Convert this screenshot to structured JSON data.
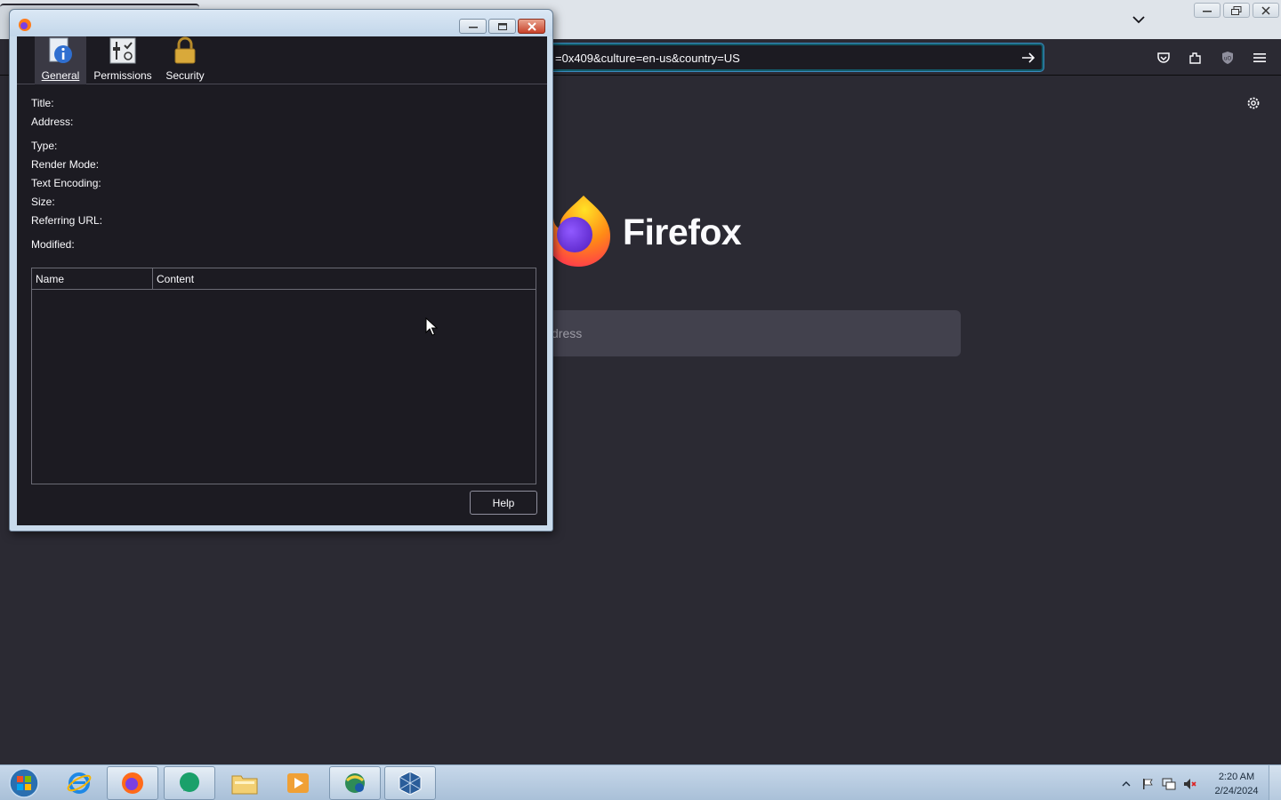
{
  "browser": {
    "url_text": "=0x409&culture=en-us&country=US",
    "brand": "Firefox",
    "search_placeholder": "dress"
  },
  "dialog": {
    "tabs": [
      {
        "label": "General",
        "icon": "info-icon"
      },
      {
        "label": "Permissions",
        "icon": "permissions-icon"
      },
      {
        "label": "Security",
        "icon": "lock-icon"
      }
    ],
    "fields": {
      "title": "Title:",
      "address": "Address:",
      "type": "Type:",
      "render_mode": "Render Mode:",
      "text_encoding": "Text Encoding:",
      "size": "Size:",
      "referring_url": "Referring URL:",
      "modified": "Modified:"
    },
    "table": {
      "columns": [
        "Name",
        "Content"
      ]
    },
    "help_label": "Help"
  },
  "taskbar": {
    "clock_time": "2:20 AM",
    "clock_date": "2/24/2024",
    "apps": [
      "internet-explorer",
      "firefox",
      "app-green",
      "file-explorer",
      "media-player",
      "network-app",
      "virtualbox"
    ]
  },
  "colors": {
    "browser_bg": "#2b2a33",
    "dialog_bg": "#1c1b22",
    "taskbar": "#b8cce0"
  }
}
